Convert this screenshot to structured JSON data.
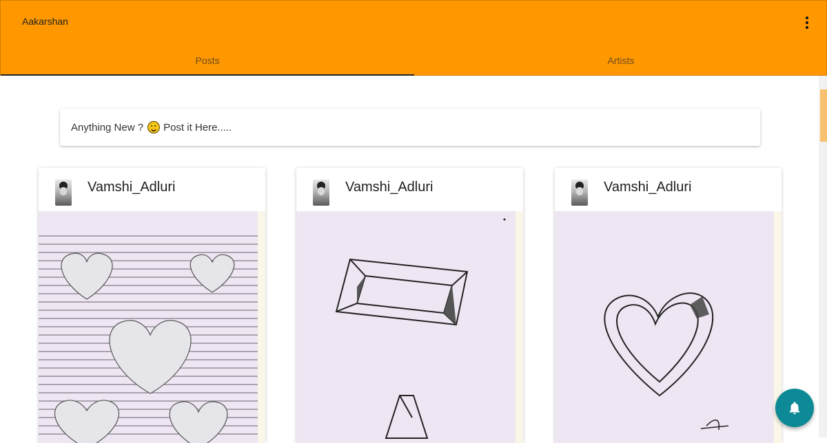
{
  "app": {
    "title": "Aakarshan"
  },
  "tabs": [
    {
      "label": "Posts",
      "active": true
    },
    {
      "label": "Artists",
      "active": false
    }
  ],
  "composer": {
    "text_before": "Anything New ?",
    "emoji": "grinning-face",
    "text_after": "Post it Here....."
  },
  "posts": [
    {
      "author": "Vamshi_Adluri",
      "drawing": "shaded 3D hearts on lined paper"
    },
    {
      "author": "Vamshi_Adluri",
      "drawing": "impossible rectangle and triangle"
    },
    {
      "author": "Vamshi_Adluri",
      "drawing": "impossible heart with signature"
    }
  ],
  "colors": {
    "appbar": "#ff9800",
    "fab": "#0d8a96",
    "paper": "#eee6f2"
  },
  "icons": {
    "menu": "more-vert-icon",
    "notifications": "bell-icon"
  }
}
